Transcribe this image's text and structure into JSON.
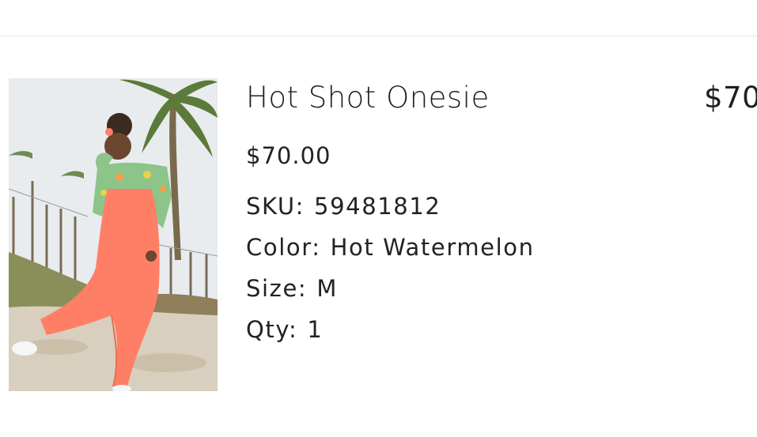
{
  "cart_item": {
    "title": "Hot Shot Onesie",
    "price": "$70.00",
    "line_total": "$70",
    "sku_label": "SKU:",
    "sku_value": "59481812",
    "color_label": "Color:",
    "color_value": "Hot Watermelon",
    "size_label": "Size:",
    "size_value": "M",
    "qty_label": "Qty:",
    "qty_value": "1",
    "image": {
      "depicts": "model in coral jumpsuit on beach",
      "accent_color": "#ff7f66"
    }
  }
}
